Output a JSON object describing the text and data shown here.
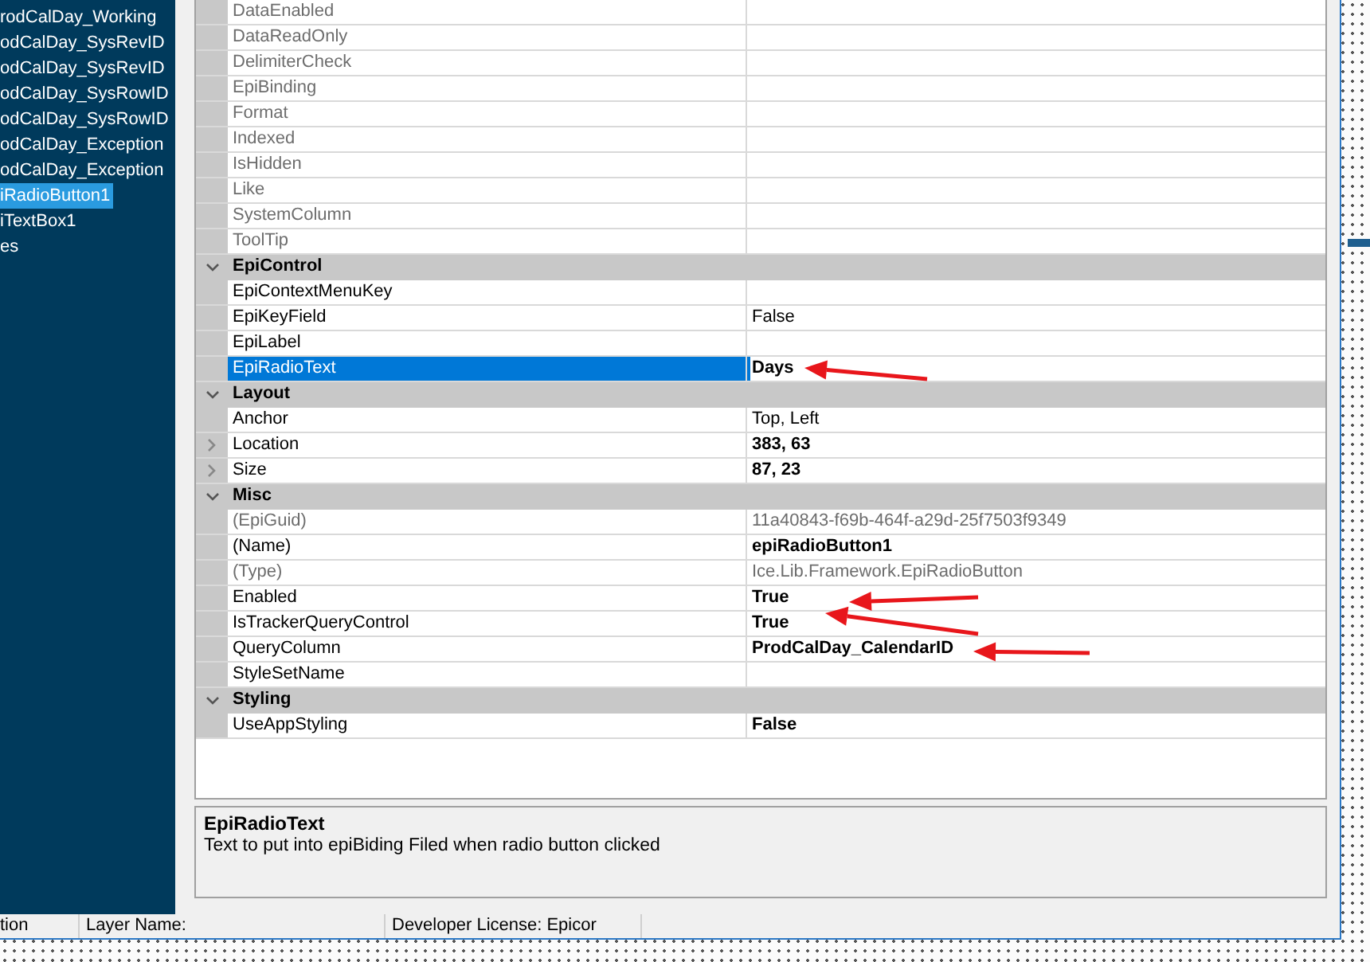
{
  "tree": {
    "items": [
      {
        "label": "rodCalDay_Working",
        "selected": false
      },
      {
        "label": "odCalDay_SysRevID",
        "selected": false
      },
      {
        "label": "odCalDay_SysRevID",
        "selected": false
      },
      {
        "label": "odCalDay_SysRowID",
        "selected": false
      },
      {
        "label": "odCalDay_SysRowID",
        "selected": false
      },
      {
        "label": "odCalDay_Exception",
        "selected": false
      },
      {
        "label": "odCalDay_Exception",
        "selected": false
      },
      {
        "label": "iRadioButton1",
        "selected": true
      },
      {
        "label": "iTextBox1",
        "selected": false
      },
      {
        "label": "es",
        "selected": false
      }
    ]
  },
  "grid": {
    "rows": [
      {
        "kind": "property",
        "name": "DataEnabled",
        "disabled": true,
        "selected": false
      },
      {
        "kind": "property",
        "name": "DataReadOnly",
        "disabled": true,
        "selected": false
      },
      {
        "kind": "property",
        "name": "DelimiterCheck",
        "disabled": true,
        "selected": false
      },
      {
        "kind": "property",
        "name": "EpiBinding",
        "disabled": true,
        "selected": false
      },
      {
        "kind": "property",
        "name": "Format",
        "disabled": true,
        "selected": false
      },
      {
        "kind": "property",
        "name": "Indexed",
        "disabled": true,
        "selected": false
      },
      {
        "kind": "property",
        "name": "IsHidden",
        "disabled": true,
        "selected": false
      },
      {
        "kind": "property",
        "name": "Like",
        "disabled": true,
        "selected": false
      },
      {
        "kind": "property",
        "name": "SystemColumn",
        "disabled": true,
        "selected": false
      },
      {
        "kind": "property",
        "name": "ToolTip",
        "disabled": true,
        "selected": false
      },
      {
        "kind": "category",
        "name": "EpiControl",
        "expanded": true
      },
      {
        "kind": "property",
        "name": "EpiContextMenuKey",
        "disabled": false,
        "selected": false
      },
      {
        "kind": "property",
        "name": "EpiKeyField",
        "value": "False",
        "disabled": false,
        "modified": false,
        "selected": false
      },
      {
        "kind": "property",
        "name": "EpiLabel",
        "disabled": false,
        "selected": false
      },
      {
        "kind": "property",
        "name": "EpiRadioText",
        "value": "Days",
        "disabled": false,
        "modified": true,
        "selected": true
      },
      {
        "kind": "category",
        "name": "Layout",
        "expanded": true
      },
      {
        "kind": "property",
        "name": "Anchor",
        "value": "Top, Left",
        "disabled": false,
        "modified": false,
        "selected": false
      },
      {
        "kind": "property",
        "name": "Location",
        "value": "383, 63",
        "disabled": false,
        "modified": true,
        "selected": false,
        "expanded": false
      },
      {
        "kind": "property",
        "name": "Size",
        "value": "87, 23",
        "disabled": false,
        "modified": true,
        "selected": false,
        "expanded": false
      },
      {
        "kind": "category",
        "name": "Misc",
        "expanded": true
      },
      {
        "kind": "property",
        "name": "(EpiGuid)",
        "value": "11a40843-f69b-464f-a29d-25f7503f9349",
        "disabled": true,
        "modified": false,
        "selected": false
      },
      {
        "kind": "property",
        "name": "(Name)",
        "value": "epiRadioButton1",
        "disabled": false,
        "modified": true,
        "selected": false
      },
      {
        "kind": "property",
        "name": "(Type)",
        "value": "Ice.Lib.Framework.EpiRadioButton",
        "disabled": true,
        "modified": false,
        "selected": false
      },
      {
        "kind": "property",
        "name": "Enabled",
        "value": "True",
        "disabled": false,
        "modified": true,
        "selected": false
      },
      {
        "kind": "property",
        "name": "IsTrackerQueryControl",
        "value": "True",
        "disabled": false,
        "modified": true,
        "selected": false
      },
      {
        "kind": "property",
        "name": "QueryColumn",
        "value": "ProdCalDay_CalendarID",
        "disabled": false,
        "modified": true,
        "selected": false
      },
      {
        "kind": "property",
        "name": "StyleSetName",
        "disabled": false,
        "selected": false
      },
      {
        "kind": "category",
        "name": "Styling",
        "expanded": true
      },
      {
        "kind": "property",
        "name": "UseAppStyling",
        "value": "False",
        "disabled": false,
        "modified": true,
        "selected": false
      }
    ]
  },
  "description": {
    "title": "EpiRadioText",
    "text": "Text to put into epiBiding Filed when radio button clicked"
  },
  "status_bar": [
    {
      "text": "tion"
    },
    {
      "text": "Layer Name:"
    },
    {
      "text": "Developer License:  Epicor"
    }
  ]
}
